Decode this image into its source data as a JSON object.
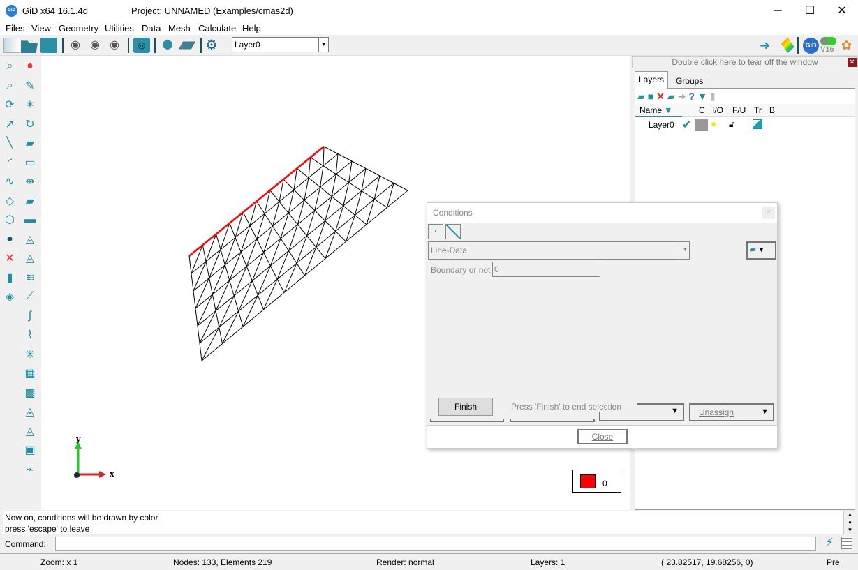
{
  "window": {
    "app_title": "GiD x64 16.1.4d",
    "project_title": "Project: UNNAMED (Examples/cmas2d)",
    "logo": "GiD",
    "minimize": "─",
    "maximize": "☐",
    "close": "✕"
  },
  "menu": [
    "Files",
    "View",
    "Geometry",
    "Utilities",
    "Data",
    "Mesh",
    "Calculate",
    "Help"
  ],
  "toolbar": {
    "layer_select": "Layer0",
    "version_badge": "V16",
    "icons": [
      "new-file",
      "open-folder",
      "save",
      "rotate-left",
      "rotate-right",
      "view-eye",
      "screenshot-camera",
      "mesh-generate",
      "layer-plane",
      "settings-gear"
    ]
  },
  "right_panel": {
    "tear_off": "Double click here to tear off the window",
    "tabs": [
      "Layers",
      "Groups"
    ],
    "columns": [
      "Name",
      "C",
      "I/O",
      "F/U",
      "Tr",
      "B"
    ],
    "layers": [
      {
        "name": "Layer0",
        "color": "#999999"
      }
    ]
  },
  "conditions": {
    "title": "Conditions",
    "condition_select": "Line-Data",
    "field_label": "Boundary or not",
    "field_value": "0",
    "finish": "Finish",
    "hint": "Press 'Finish' to end selection",
    "unassign": "Unassign",
    "close": "Close"
  },
  "canvas": {
    "axis_x": "x",
    "axis_y": "y",
    "legend_value": "0",
    "legend_color": "#ff0000",
    "condition_color": "#ff0000"
  },
  "messages": [
    "Now on, conditions will be drawn by color",
    "press 'escape' to leave"
  ],
  "command": {
    "label": "Command:",
    "value": ""
  },
  "status": {
    "zoom": "Zoom: x 1",
    "counts": "Nodes: 133, Elements 219",
    "render": "Render: normal",
    "layers": "Layers: 1",
    "coords": "( 23.82517,  19.68256,  0)",
    "mode": "Pre"
  }
}
